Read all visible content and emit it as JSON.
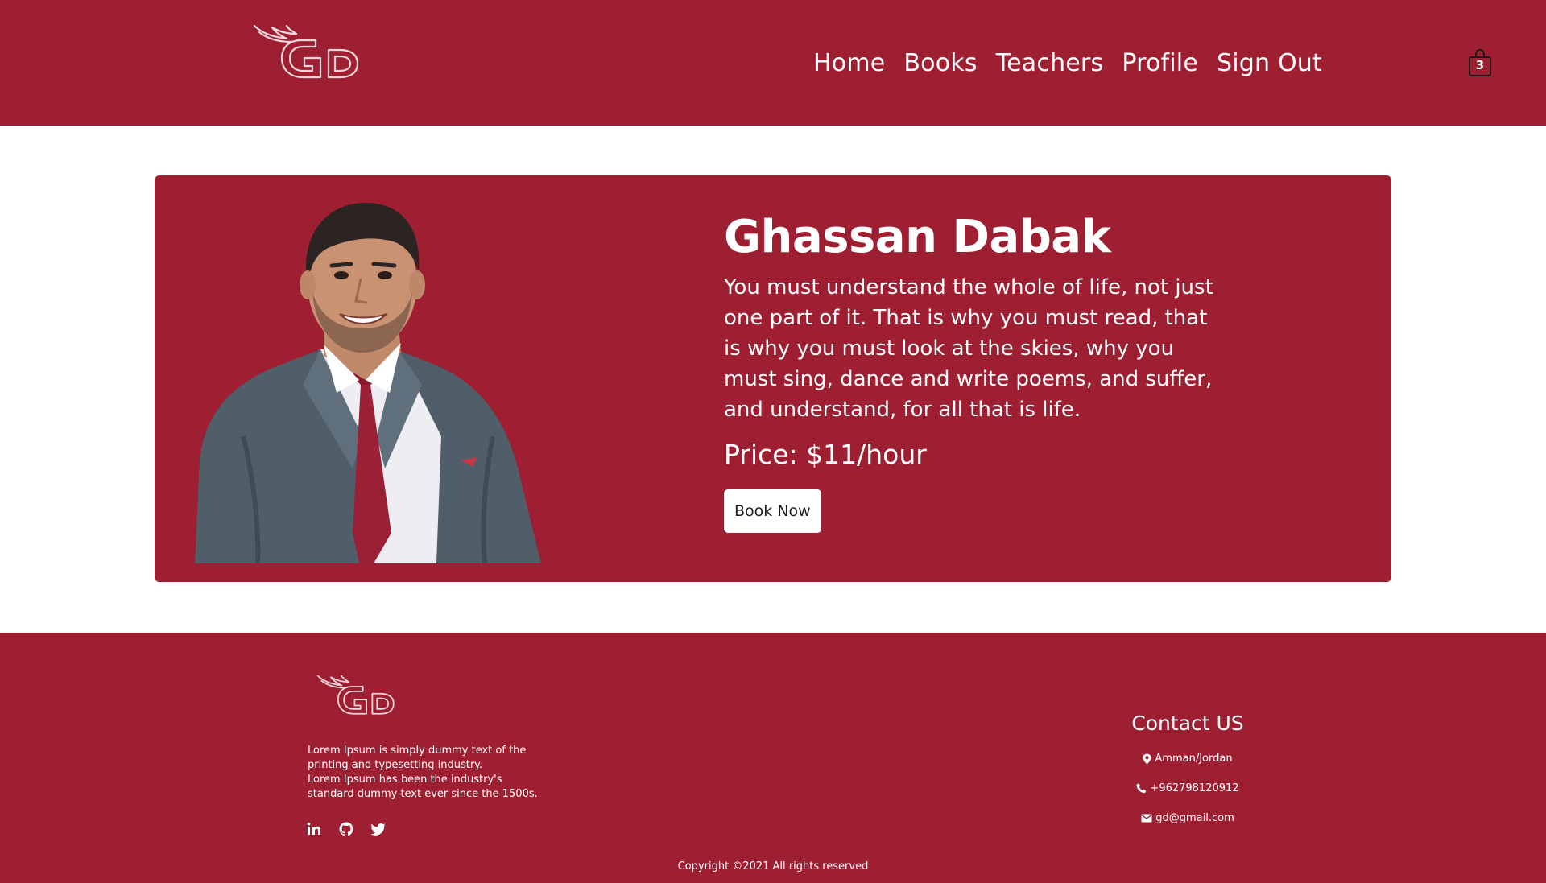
{
  "colors": {
    "brand": "#9e1f32",
    "background": "#ffffff",
    "button_bg": "#ffffff",
    "button_text": "#1c1c1c"
  },
  "header": {
    "logo_icon": "winged-gd-logo",
    "nav": [
      {
        "label": "Home"
      },
      {
        "label": "Books"
      },
      {
        "label": "Teachers"
      },
      {
        "label": "Profile"
      },
      {
        "label": "Sign Out"
      }
    ],
    "cart": {
      "icon": "shopping-bag-icon",
      "count": "3"
    }
  },
  "teacher": {
    "name": "Ghassan Dabak",
    "quote": "You must understand the whole of life, not just one part of it. That is why you must read, that is why you must look at the skies, why you must sing, dance and write poems, and suffer, and understand, for all that is life.",
    "price": "Price: $11/hour",
    "button_label": "Book Now"
  },
  "footer": {
    "logo_icon": "winged-gd-logo",
    "about_line1": "Lorem Ipsum is simply dummy text of the printing and typesetting industry.",
    "about_line2": "Lorem Ipsum has been the industry's standard dummy text ever since the 1500s.",
    "socials": [
      "linkedin-icon",
      "github-icon",
      "twitter-icon"
    ],
    "contact_title": "Contact US",
    "contact": {
      "location": "Amman/Jordan",
      "phone": "+962798120912",
      "email": "gd@gmail.com"
    },
    "copyright": "Copyright ©2021 All rights reserved"
  }
}
